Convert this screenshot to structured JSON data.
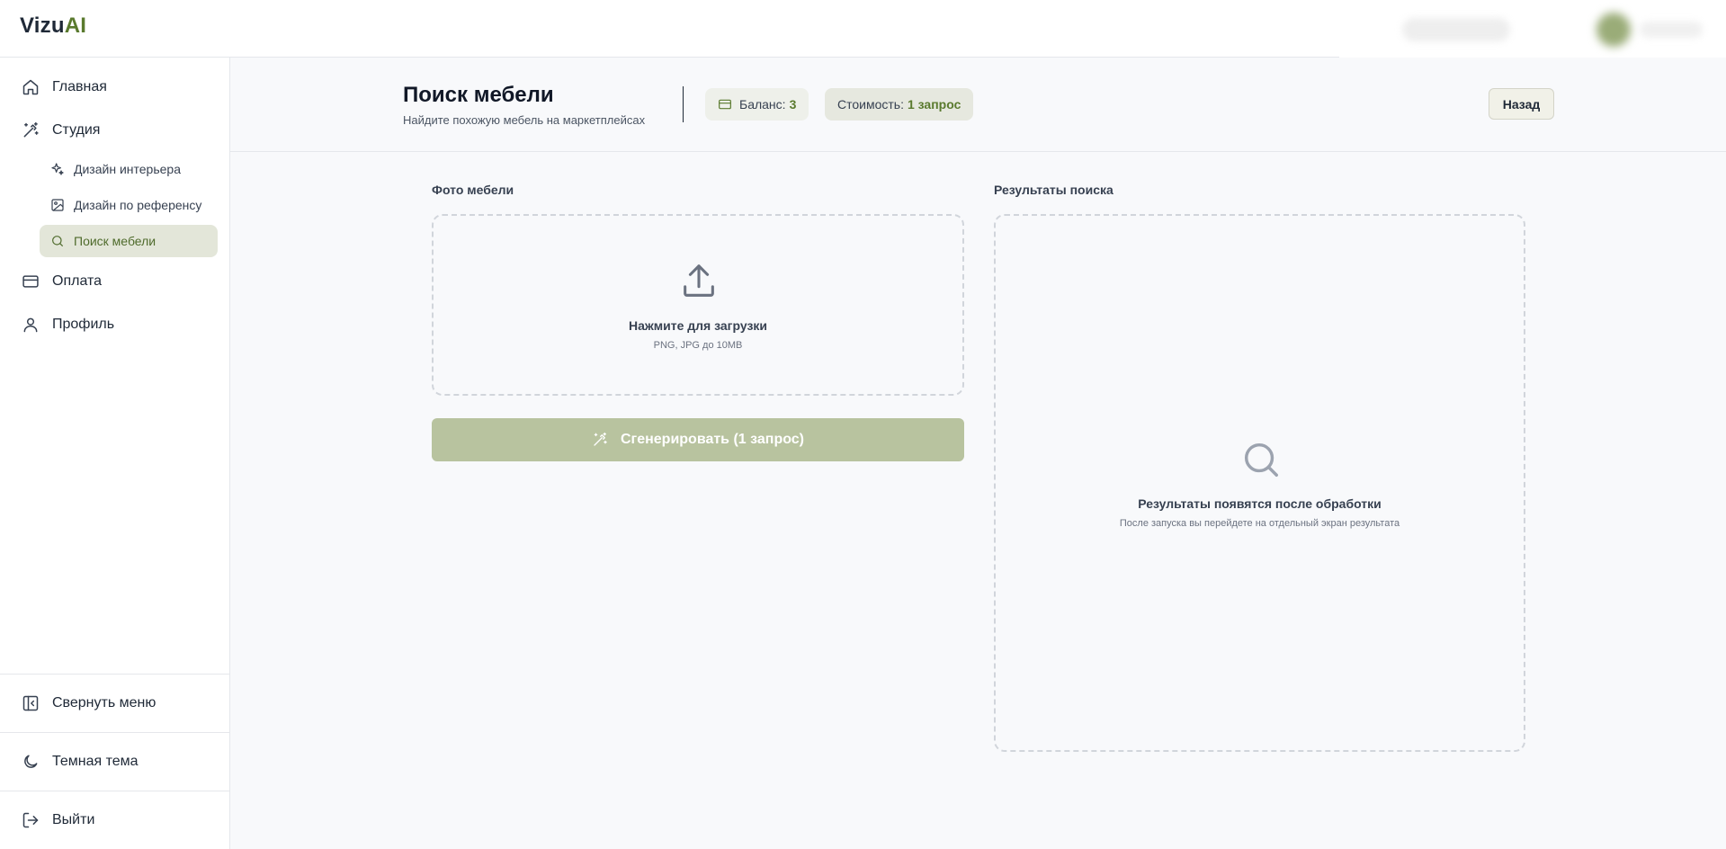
{
  "app": {
    "logo_main": "Vizu",
    "logo_accent": "AI"
  },
  "sidebar": {
    "items": [
      {
        "label": "Главная",
        "icon": "home-icon"
      },
      {
        "label": "Студия",
        "icon": "magic-wand-icon"
      },
      {
        "label": "Оплата",
        "icon": "credit-card-icon"
      },
      {
        "label": "Профиль",
        "icon": "user-icon"
      }
    ],
    "sub_items": [
      {
        "label": "Дизайн интерьера",
        "icon": "sparkles-icon"
      },
      {
        "label": "Дизайн по референсу",
        "icon": "image-icon"
      },
      {
        "label": "Поиск мебели",
        "icon": "search-icon",
        "active": true
      }
    ],
    "collapse_label": "Свернуть меню",
    "theme_label": "Темная тема",
    "logout_label": "Выйти"
  },
  "header": {
    "title": "Поиск мебели",
    "subtitle": "Найдите похожую мебель на маркетплейсах",
    "balance_label": "Баланс:",
    "balance_value": "3",
    "cost_label": "Стоимость:",
    "cost_value": "1 запрос",
    "back_label": "Назад"
  },
  "upload": {
    "section_label": "Фото мебели",
    "title": "Нажмите для загрузки",
    "hint": "PNG, JPG до 10MB"
  },
  "generate": {
    "label": "Сгенерировать (1 запрос)"
  },
  "results": {
    "section_label": "Результаты поиска",
    "title": "Результаты появятся после обработки",
    "hint": "После запуска вы перейдете на отдельный экран результата"
  },
  "colors": {
    "accent": "#5a7a2e",
    "active_bg": "#e3e6d9",
    "button_bg": "#b8c39f"
  }
}
